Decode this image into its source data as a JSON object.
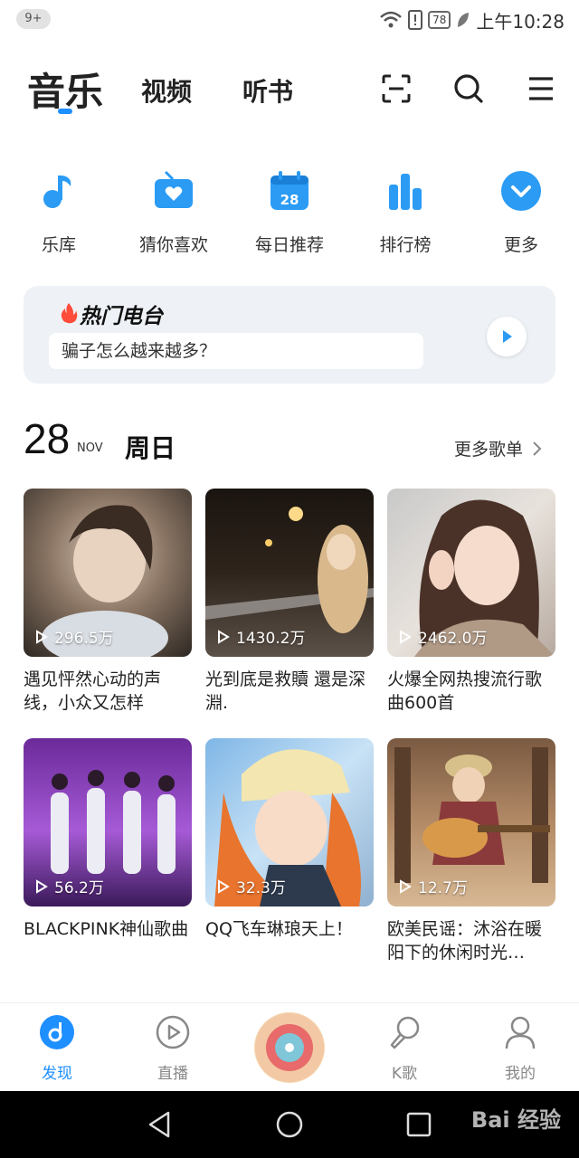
{
  "status_bar": {
    "notif_badge": "9+",
    "battery": "78",
    "time": "上午10:28"
  },
  "header": {
    "tabs": [
      {
        "label": "音乐"
      },
      {
        "label": "视频"
      },
      {
        "label": "听书"
      }
    ],
    "icons": [
      "scan-icon",
      "search-icon",
      "menu-icon"
    ]
  },
  "quick_entries": [
    {
      "label": "乐库",
      "icon": "music-note-icon"
    },
    {
      "label": "猜你喜欢",
      "icon": "radio-heart-icon"
    },
    {
      "label": "每日推荐",
      "icon": "calendar-icon",
      "calendar_day": "28"
    },
    {
      "label": "排行榜",
      "icon": "bar-chart-icon"
    },
    {
      "label": "更多",
      "icon": "chevron-down-icon"
    }
  ],
  "radio": {
    "title": "热门电台",
    "text": "骗子怎么越来越多？"
  },
  "date": {
    "day": "28",
    "month": "NOV",
    "weekday": "周日",
    "more_label": "更多歌单"
  },
  "playlists": [
    {
      "count": "296.5万",
      "title": "遇见怦然心动的声线，小众又怎样"
    },
    {
      "count": "1430.2万",
      "title": "光到底是救贖 還是深淵."
    },
    {
      "count": "2462.0万",
      "title": "火爆全网热搜流行歌曲600首"
    },
    {
      "count": "56.2万",
      "title": "BLACKPINK神仙歌曲"
    },
    {
      "count": "32.3万",
      "title": "QQ飞车琳琅天上！"
    },
    {
      "count": "12.7万",
      "title": "欧美民谣：沐浴在暖阳下的休闲时光…"
    }
  ],
  "bottom_nav": [
    {
      "label": "发现",
      "icon": "discover-icon",
      "active": true
    },
    {
      "label": "直播",
      "icon": "live-play-icon"
    },
    {
      "label": "",
      "icon": "center-album-icon"
    },
    {
      "label": "K歌",
      "icon": "mic-icon"
    },
    {
      "label": "我的",
      "icon": "user-icon"
    }
  ],
  "colors": {
    "accent": "#1e8fff",
    "icon_blue": "#2b9bf4"
  },
  "watermark": "Bai 经验"
}
